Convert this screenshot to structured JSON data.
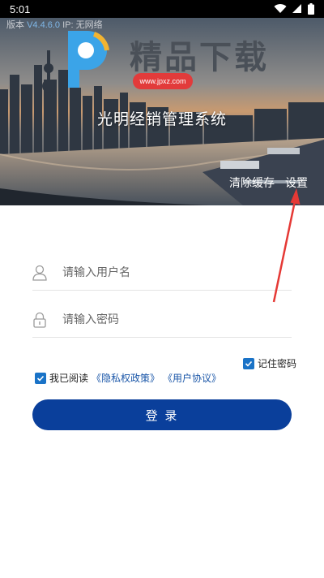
{
  "status_bar": {
    "time": "5:01"
  },
  "banner": {
    "version_prefix": "版本",
    "version_number": "V4.4.6.0",
    "ip_label": "IP: 无网络",
    "watermark_text": "精品下载",
    "watermark_sub": "www.jpxz.com",
    "system_title": "光明经销管理系统",
    "clear_cache_label": "清除缓存",
    "settings_label": "设置"
  },
  "login_form": {
    "username_placeholder": "请输入用户名",
    "username_value": "",
    "password_placeholder": "请输入密码",
    "password_value": "",
    "remember_password_label": "记住密码",
    "remember_password_checked": true,
    "agree_checked": true,
    "agree_prefix": "我已阅读",
    "privacy_policy_link": "《隐私权政策》",
    "user_agreement_link": "《用户协议》",
    "login_button_label": "登 录"
  },
  "colors": {
    "primary_button": "#0a3f9b",
    "checkbox": "#1a73c7",
    "link": "#1a56a8",
    "annotation_arrow": "#e53935"
  },
  "icons": {
    "username": "user-icon",
    "password": "lock-icon",
    "checkbox": "check-icon"
  }
}
